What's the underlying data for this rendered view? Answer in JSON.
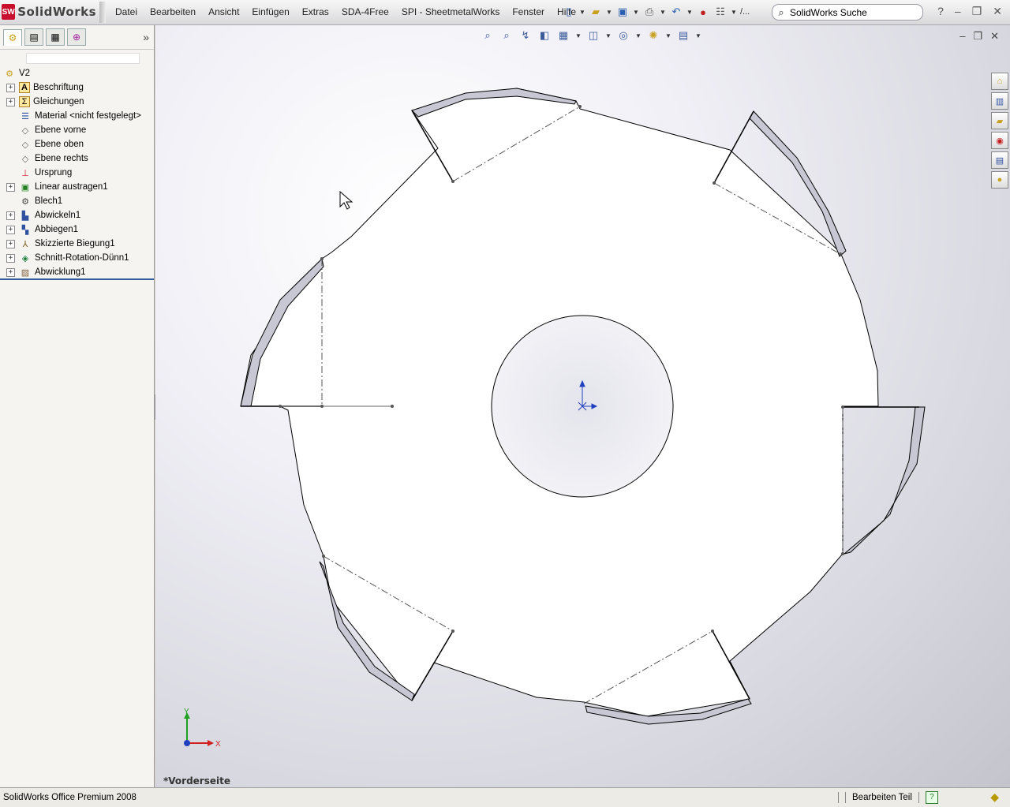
{
  "app": {
    "name": "SolidWorks",
    "badge": "SW"
  },
  "menu": [
    "Datei",
    "Bearbeiten",
    "Ansicht",
    "Einfügen",
    "Extras",
    "SDA-4Free",
    "SPI - SheetmetalWorks",
    "Fenster",
    "Hilfe"
  ],
  "search": {
    "placeholder": "SolidWorks Suche"
  },
  "toolbar": {
    "ellipsis": "/..."
  },
  "tree": {
    "root": "V2",
    "items": [
      {
        "label": "Beschriftung",
        "icon": "annotation-icon",
        "expandable": true
      },
      {
        "label": "Gleichungen",
        "icon": "equation-icon",
        "expandable": true
      },
      {
        "label": "Material <nicht festgelegt>",
        "icon": "material-icon",
        "expandable": false
      },
      {
        "label": "Ebene vorne",
        "icon": "plane-icon",
        "expandable": false
      },
      {
        "label": "Ebene oben",
        "icon": "plane-icon",
        "expandable": false
      },
      {
        "label": "Ebene rechts",
        "icon": "plane-icon",
        "expandable": false
      },
      {
        "label": "Ursprung",
        "icon": "origin-icon",
        "expandable": false
      },
      {
        "label": "Linear austragen1",
        "icon": "extrude-icon",
        "expandable": true
      },
      {
        "label": "Blech1",
        "icon": "sheetmetal-icon",
        "expandable": false
      },
      {
        "label": "Abwickeln1",
        "icon": "unfold-icon",
        "expandable": true
      },
      {
        "label": "Abbiegen1",
        "icon": "fold-icon",
        "expandable": true
      },
      {
        "label": "Skizzierte Biegung1",
        "icon": "sketched-bend-icon",
        "expandable": true
      },
      {
        "label": "Schnitt-Rotation-Dünn1",
        "icon": "revolve-cut-icon",
        "expandable": true
      },
      {
        "label": "Abwicklung1",
        "icon": "flat-pattern-icon",
        "expandable": true
      }
    ]
  },
  "viewport": {
    "view_label": "*Vorderseite",
    "axes": {
      "x": "X",
      "y": "Y"
    },
    "colors": {
      "background": "#e6e6ee",
      "part_face": "#ffffff",
      "edge": "#000000",
      "flange": "#c8c8d4",
      "triad_x": "#d02020",
      "triad_y": "#20a020",
      "triad_z": "#2040c0"
    }
  },
  "status": {
    "product": "SolidWorks Office Premium 2008",
    "mode": "Bearbeiten Teil",
    "help": "?"
  }
}
